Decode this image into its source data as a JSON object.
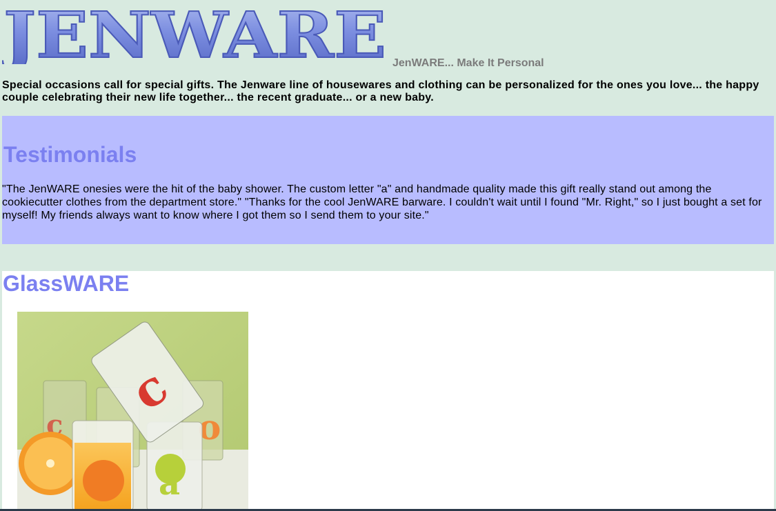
{
  "header": {
    "logo_text": "JENWARE",
    "tagline": "JenWARE... Make It Personal"
  },
  "intro": "Special occasions call for special gifts. The Jenware line of housewares and clothing can be personalized for the ones you love... the happy couple celebrating their new life together... the recent graduate... or a new baby.",
  "testimonials": {
    "heading": "Testimonials",
    "text": "\"The JenWARE onesies were the hit of the baby shower. The custom letter \"a\" and handmade quality made this gift really stand out among the cookiecutter clothes from the department store.\" \"Thanks for the cool JenWARE barware. I couldn't wait until I found \"Mr. Right,\" so I just bought a set for myself! My friends always want to know where I got them so I send them to your site.\""
  },
  "glassware": {
    "heading": "GlassWARE",
    "image_letters": [
      "c",
      "a",
      "o",
      "c"
    ]
  },
  "colors": {
    "page_bg": "#d8eae0",
    "testimonial_bg": "#b8bcff",
    "heading": "#7b80f0",
    "logo": "#6f7fd6"
  }
}
